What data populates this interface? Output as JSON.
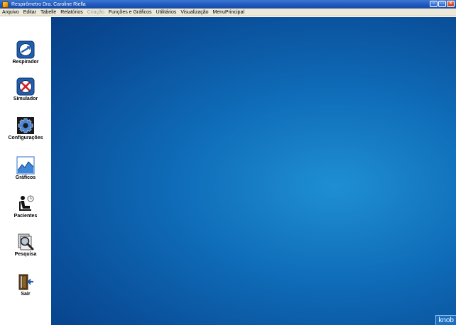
{
  "window": {
    "title": "Respirômetro Dra. Caroline Riella",
    "minimize": "−",
    "maximize": "□",
    "close": "×"
  },
  "menu": [
    {
      "label": "Arquivo",
      "enabled": true
    },
    {
      "label": "Editar",
      "enabled": true
    },
    {
      "label": "Tabelle",
      "enabled": true
    },
    {
      "label": "Relatórios",
      "enabled": true
    },
    {
      "label": "Criação",
      "enabled": false
    },
    {
      "label": "Funções e Gráficos",
      "enabled": true
    },
    {
      "label": "Utilitários",
      "enabled": true
    },
    {
      "label": "Visualização",
      "enabled": true
    },
    {
      "label": "MenuPrincipal",
      "enabled": true
    }
  ],
  "sidebar": {
    "items": [
      {
        "label": "Respirador",
        "icon": "respirator-icon"
      },
      {
        "label": "Simulador",
        "icon": "simulator-icon"
      },
      {
        "label": "Configurações",
        "icon": "settings-gear-icon"
      },
      {
        "label": "Gráficos",
        "icon": "chart-icon"
      },
      {
        "label": "Pacientes",
        "icon": "patient-icon"
      },
      {
        "label": "Pesquisa",
        "icon": "search-icon"
      },
      {
        "label": "Sair",
        "icon": "exit-door-icon"
      }
    ]
  },
  "desktop": {
    "brand": "knob"
  },
  "colors": {
    "titlebar": "#1f56b8",
    "menubar": "#ece9d8",
    "desktop": "#0f6cb8"
  }
}
